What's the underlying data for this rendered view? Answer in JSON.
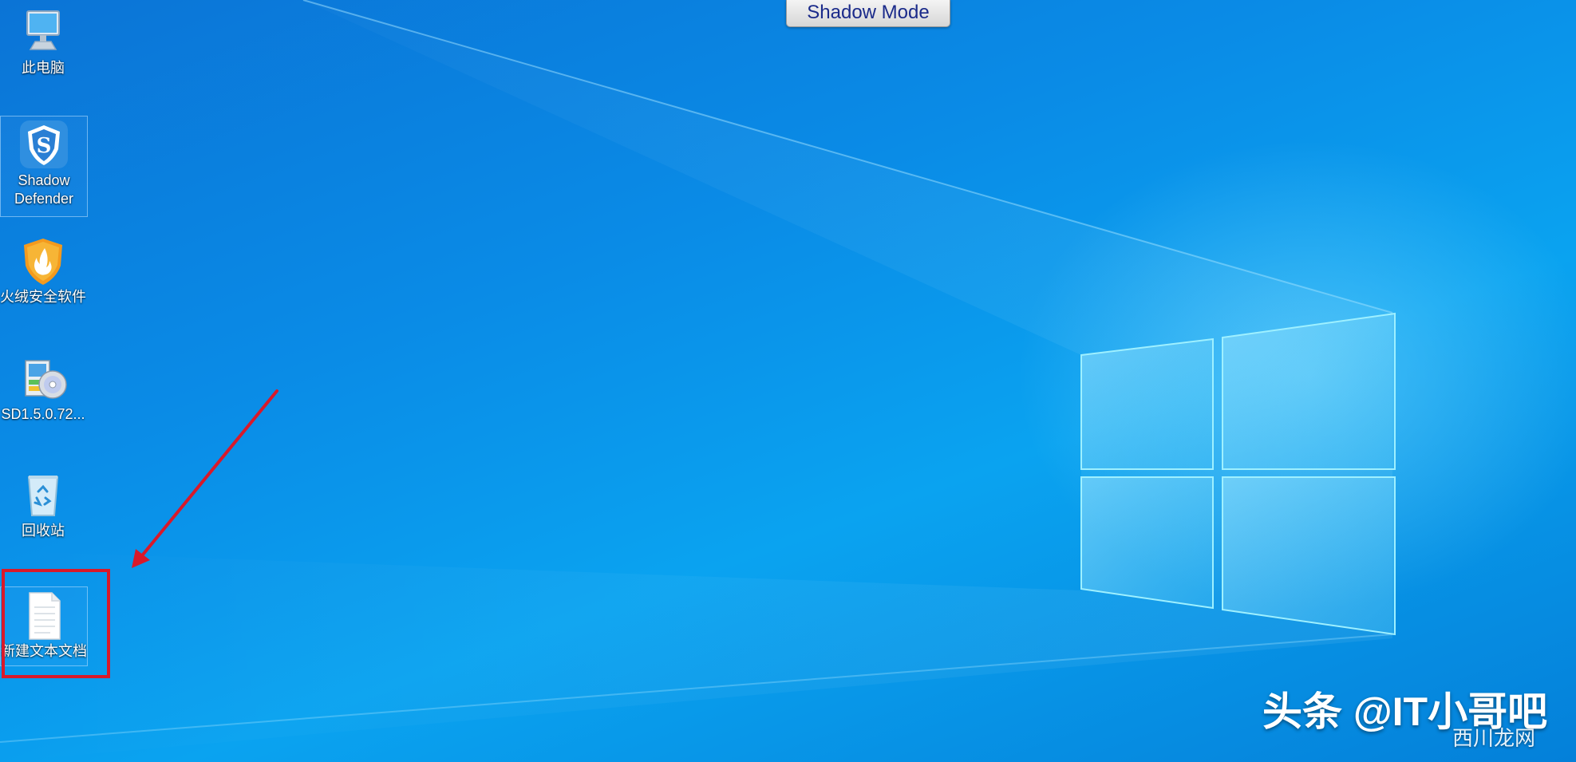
{
  "banner": {
    "text": "Shadow Mode"
  },
  "desktop_icons": [
    {
      "label": "此电脑",
      "icon": "this-pc-icon"
    },
    {
      "label": "Shadow Defender",
      "icon": "shadow-defender-icon"
    },
    {
      "label": "火绒安全软件",
      "icon": "huorong-security-icon"
    },
    {
      "label": "SD1.5.0.72...",
      "icon": "installer-disc-icon"
    },
    {
      "label": "回收站",
      "icon": "recycle-bin-icon"
    },
    {
      "label": "新建文本文档",
      "icon": "text-document-icon"
    }
  ],
  "watermark": {
    "main": "头条 @IT小哥吧",
    "sub": "西川龙网"
  },
  "colors": {
    "annotation": "#d9192a",
    "banner_text": "#1a2a8a",
    "wallpaper_base": "#0a8be6"
  }
}
